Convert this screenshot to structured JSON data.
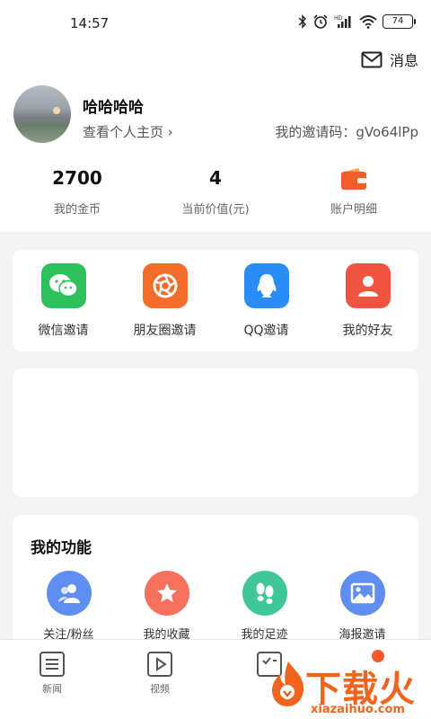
{
  "status": {
    "time": "14:57",
    "battery": "74"
  },
  "header": {
    "messages_label": "消息"
  },
  "profile": {
    "username": "哈哈哈哈",
    "profile_link": "查看个人主页",
    "invite_code_label": "我的邀请码：",
    "invite_code": "gVo64lPp"
  },
  "stats": [
    {
      "value": "2700",
      "label": "我的金币"
    },
    {
      "value": "4",
      "label": "当前价值(元)"
    },
    {
      "value": "",
      "label": "账户明细",
      "icon": "wallet-icon"
    }
  ],
  "share": [
    {
      "label": "微信邀请",
      "icon": "wechat-icon",
      "color": "#2dc15b"
    },
    {
      "label": "朋友圈邀请",
      "icon": "aperture-icon",
      "color": "#f26c2a"
    },
    {
      "label": "QQ邀请",
      "icon": "qq-icon",
      "color": "#2a8df5"
    },
    {
      "label": "我的好友",
      "icon": "user-icon",
      "color": "#f0533f"
    }
  ],
  "functions": {
    "title": "我的功能",
    "items": [
      {
        "label": "关注/粉丝",
        "icon": "users-icon",
        "color": "#5e8ff0"
      },
      {
        "label": "我的收藏",
        "icon": "star-icon",
        "color": "#f5715d"
      },
      {
        "label": "我的足迹",
        "icon": "footprint-icon",
        "color": "#3fc79a"
      },
      {
        "label": "海报邀请",
        "icon": "image-icon",
        "color": "#5e8ff0"
      }
    ]
  },
  "tabbar": [
    {
      "label": "新闻",
      "icon": "news-icon"
    },
    {
      "label": "视频",
      "icon": "video-icon"
    },
    {
      "label": "",
      "icon": "task-icon"
    },
    {
      "label": "",
      "icon": "profile-icon"
    }
  ],
  "watermark": {
    "brand": "下载火",
    "site": "xiazaihuo.com"
  }
}
